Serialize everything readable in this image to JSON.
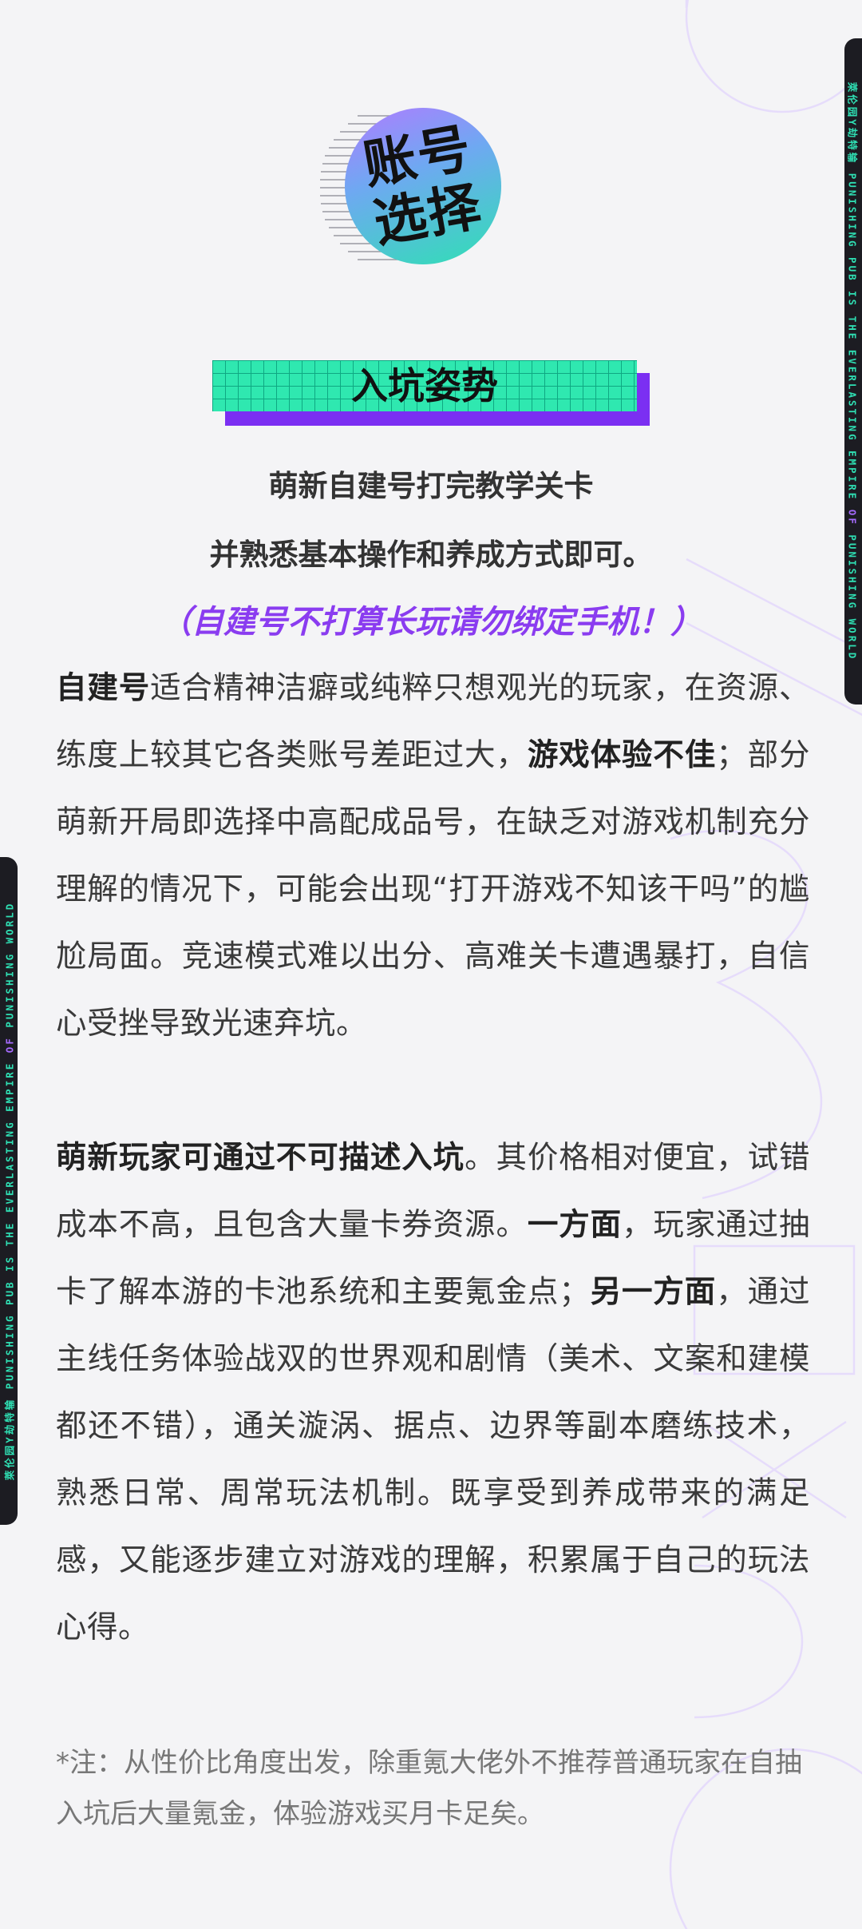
{
  "side_banner": {
    "cn": "萊伦园Y劫特输",
    "en_pre": "PUNISHING PUB IS THE EVERLASTING EMPIRE",
    "en_mid": " OF ",
    "en_post": "PUNISHING WORLD"
  },
  "badge": {
    "line1": "账号",
    "line2": "选择"
  },
  "section": {
    "title": "入坑姿势"
  },
  "intro": {
    "line1": "萌新自建号打完教学关卡",
    "line2": "并熟悉基本操作和养成方式即可。",
    "note": "（自建号不打算长玩请勿绑定手机！）"
  },
  "para1": {
    "s1_bold": "自建号",
    "s2": "适合精神洁癖或纯粹只想观光的玩家，在资源、练度上较其它各类账号差距过大，",
    "s3_bold": "游戏体验不佳",
    "s4": "；部分萌新开局即选择中高配成品号，在缺乏对游戏机制充分理解的情况下，可能会出现“打开游戏不知该干吗”的尴尬局面。竞速模式难以出分、高难关卡遭遇暴打，自信心受挫导致光速弃坑。"
  },
  "para2": {
    "s1_bold": "萌新玩家可通过不可描述入坑",
    "s2": "。其价格相对便宜，试错成本不高，且包含大量卡券资源。",
    "s3_bold": "一方面",
    "s4": "，玩家通过抽卡了解本游的卡池系统和主要氪金点；",
    "s5_bold": "另一方面",
    "s6": "，通过主线任务体验战双的世界观和剧情（美术、文案和建模都还不错），通关漩涡、据点、边界等副本磨练技术，熟悉日常、周常玩法机制。既享受到养成带来的满足感，又能逐步建立对游戏的理解，积累属于自己的玩法心得。"
  },
  "footnote": {
    "text": "*注：从性价比角度出发，除重氪大佬外不推荐普通玩家在自抽入坑后大量氪金，体验游戏买月卡足矣。"
  },
  "colors": {
    "background": "#f4f4f6",
    "accent_purple": "#8a3cf0",
    "accent_teal": "#2fe8b0",
    "side_bar": "#1c1c22"
  }
}
